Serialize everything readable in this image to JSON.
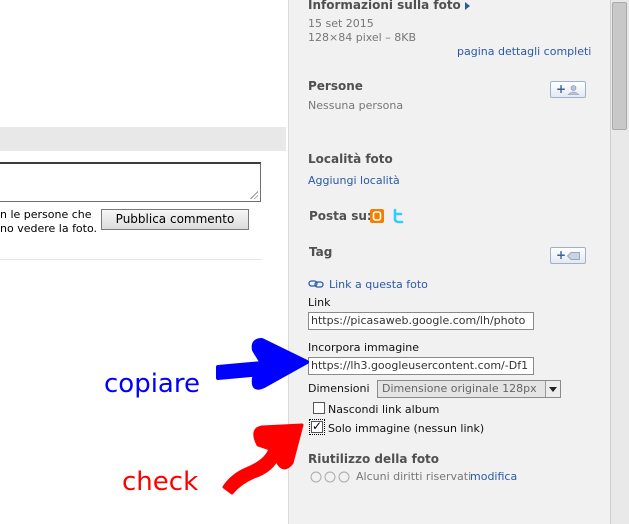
{
  "comment_section": {
    "note_line1": "n le persone che",
    "note_line2": "no vedere la foto.",
    "publish_label": "Pubblica commento"
  },
  "sidebar": {
    "photo_info": {
      "title": "Informazioni sulla foto",
      "date": "15 set 2015",
      "dims": "128×84 pixel – 8KB",
      "details_link": "pagina dettagli completi"
    },
    "people": {
      "title": "Persone",
      "empty": "Nessuna persona"
    },
    "location": {
      "title": "Località foto",
      "add_link": "Aggiungi località"
    },
    "post_to": "Posta su:",
    "tag_title": "Tag",
    "link_to_photo": "Link a questa foto",
    "link_label": "Link",
    "link_value": "https://picasaweb.google.com/lh/photo",
    "embed_label": "Incorpora immagine",
    "embed_value": "https://lh3.googleusercontent.com/-Df1",
    "dimensions_label": "Dimensioni",
    "dimensions_value": "Dimensione originale 128px",
    "hide_album_link": "Nascondi link album",
    "image_only": "Solo immagine (nessun link)",
    "reuse_title": "Riutilizzo della foto",
    "rights": "Alcuni diritti riservati",
    "modify": "modifica"
  },
  "checkboxes": {
    "hide_album_link_checked": false,
    "image_only_checked": true
  },
  "annotations": {
    "copy_text": "copiare",
    "check_text": "check"
  },
  "colors": {
    "copy_arrow": "#0000ff",
    "check_arrow": "#ff0000",
    "link": "#2a59a8",
    "panel_bg": "#f1f1f1"
  },
  "icons": [
    "triangle-right-icon",
    "add-person-icon",
    "add-tag-icon",
    "blogger-icon",
    "twitter-icon",
    "chain-link-icon",
    "cc-icon",
    "dropdown-arrow-icon"
  ]
}
